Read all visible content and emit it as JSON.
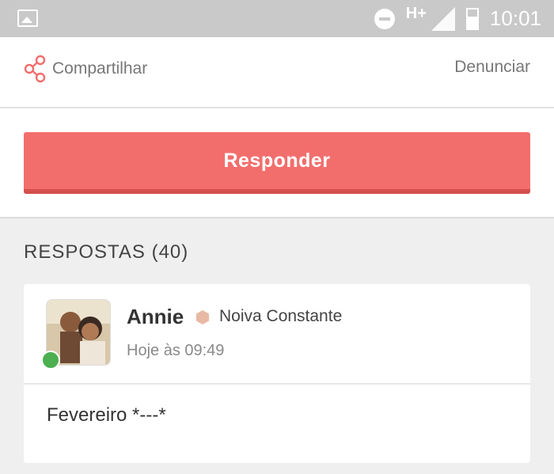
{
  "statusbar": {
    "network": "H+",
    "time": "10:01"
  },
  "actions": {
    "share_label": "Compartilhar",
    "report_label": "Denunciar"
  },
  "reply_button": "Responder",
  "answers": {
    "heading": "RESPOSTAS (40)",
    "items": [
      {
        "author": "Annie",
        "rank": "Noiva Constante",
        "time": "Hoje às 09:49",
        "message": "Fevereiro *---*",
        "online": true
      }
    ]
  },
  "colors": {
    "accent": "#f26e6c",
    "online": "#4caf50",
    "badge": "#e8b9a4"
  }
}
